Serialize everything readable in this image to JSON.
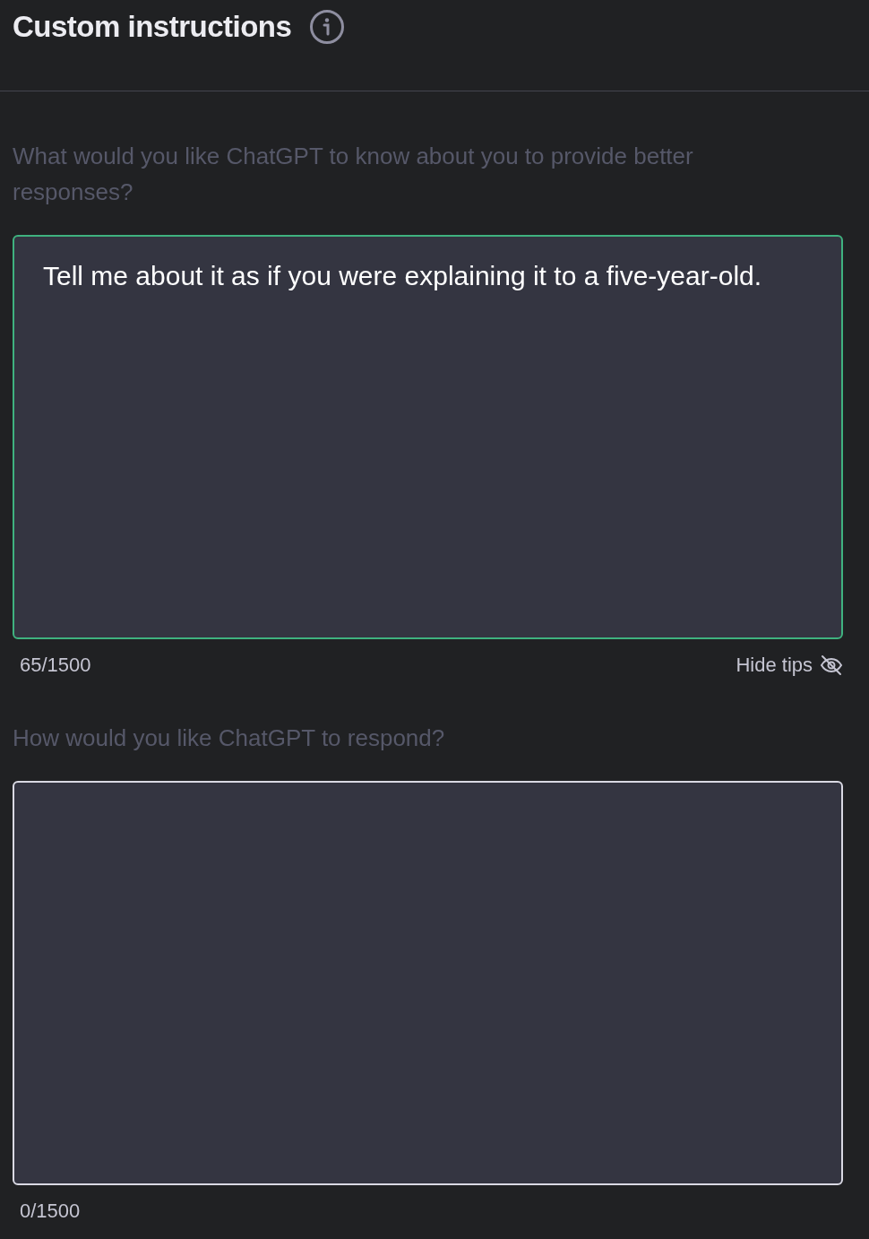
{
  "title": "Custom instructions",
  "fields": [
    {
      "label": "What would you like ChatGPT to know about you to provide better responses?",
      "value": "Tell me about it as if you were explaining it to a five-year-old.",
      "focused": true,
      "count": "65/1500",
      "tips_toggle": "Hide tips"
    },
    {
      "label": "How would you like ChatGPT to respond?",
      "focused": false,
      "count": "0/1500"
    }
  ]
}
